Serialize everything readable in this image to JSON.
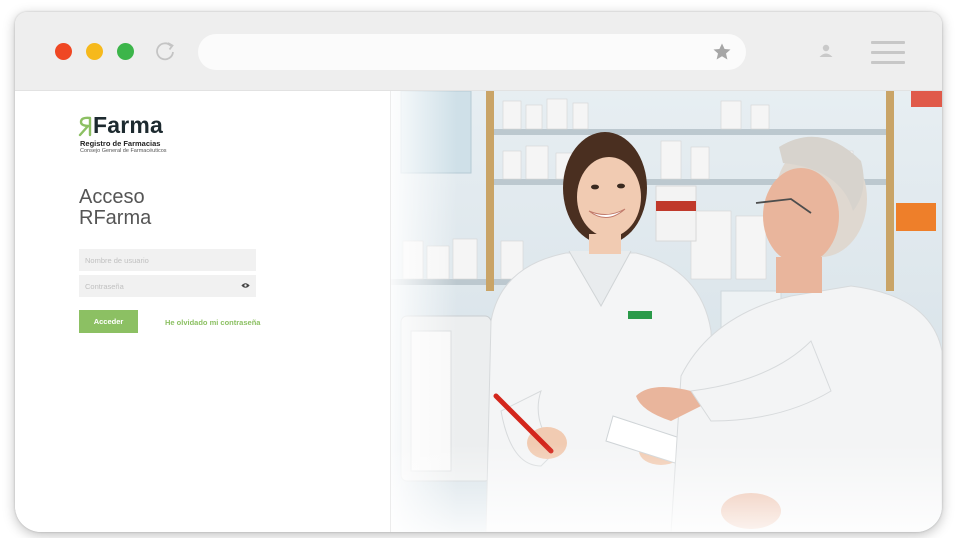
{
  "browser": {
    "controls": [
      "close",
      "minimize",
      "maximize"
    ],
    "icons": [
      "reload-icon",
      "star-icon",
      "user-icon",
      "menu-icon"
    ]
  },
  "brand": {
    "name": "Farma",
    "tagline": "Registro de Farmacias",
    "subtitle": "Consejo General de Farmacéuticos",
    "color": "#8cc063"
  },
  "login": {
    "title_line1": "Acceso",
    "title_line2": "RFarma",
    "username_placeholder": "Nombre de usuario",
    "password_placeholder": "Contraseña",
    "submit_label": "Acceder",
    "forgot_label": "He olvidado mi contraseña"
  },
  "hero": {
    "image": "pharmacist-serving-elderly-customer"
  }
}
